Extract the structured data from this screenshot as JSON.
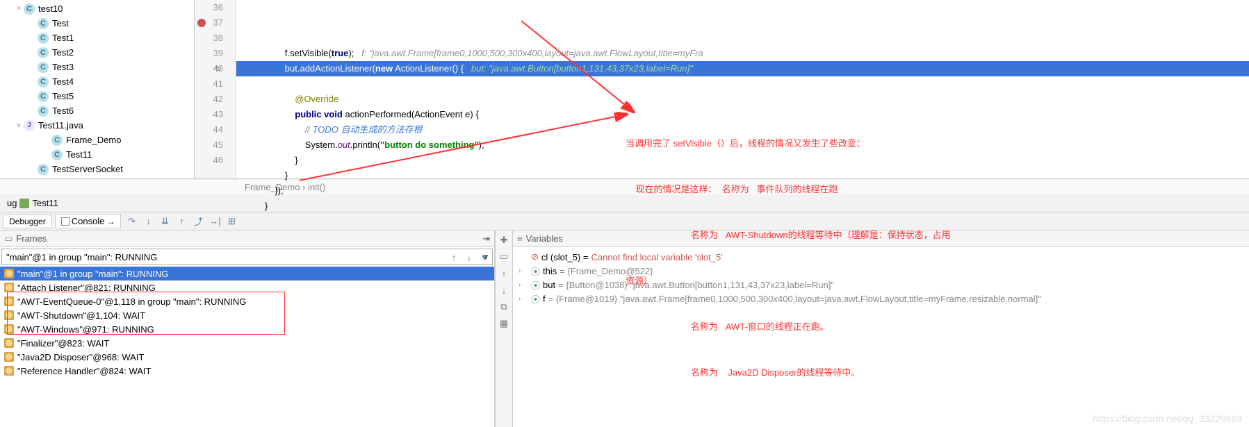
{
  "tree": {
    "items": [
      {
        "level": 0,
        "chev": ">",
        "icon": "C",
        "label": "test10"
      },
      {
        "level": 1,
        "chev": "",
        "icon": "C",
        "label": "Test"
      },
      {
        "level": 1,
        "chev": "",
        "icon": "C",
        "label": "Test1"
      },
      {
        "level": 1,
        "chev": "",
        "icon": "C",
        "label": "Test2"
      },
      {
        "level": 1,
        "chev": "",
        "icon": "C",
        "label": "Test3"
      },
      {
        "level": 1,
        "chev": "",
        "icon": "C",
        "label": "Test4"
      },
      {
        "level": 1,
        "chev": "",
        "icon": "C",
        "label": "Test5"
      },
      {
        "level": 1,
        "chev": "",
        "icon": "C",
        "label": "Test6"
      },
      {
        "level": 0,
        "chev": "v",
        "icon": "J",
        "label": "Test11.java"
      },
      {
        "level": 2,
        "chev": "",
        "icon": "C",
        "label": "Frame_Demo"
      },
      {
        "level": 2,
        "chev": "",
        "icon": "C",
        "label": "Test11"
      },
      {
        "level": 1,
        "chev": "",
        "icon": "C",
        "label": "TestServerSocket"
      }
    ]
  },
  "editor": {
    "lines": [
      {
        "n": 36,
        "bp": false,
        "indent": "                ",
        "html": "f.setVisible(<span class='kw'>true</span>);   <span class='ihint'>f: \"java.awt.Frame[frame0,1000,500,300x400,layout=java.awt.FlowLayout,title=myFra</span>"
      },
      {
        "n": 37,
        "bp": true,
        "hl": true,
        "indent": "                ",
        "html": "but.addActionListener(<span class='kw'>new</span> ActionListener() {   <span class='ihint'>but: \"java.awt.Button[button1,131,43,37x23,label=Run]\"</span>"
      },
      {
        "n": 38,
        "indent": "",
        "html": ""
      },
      {
        "n": 39,
        "indent": "                    ",
        "html": "<span class='ann'>@Override</span>"
      },
      {
        "n": 40,
        "over": true,
        "indent": "                    ",
        "html": "<span class='kw'>public void</span> actionPerformed(ActionEvent e) {"
      },
      {
        "n": 41,
        "indent": "                        ",
        "html": "<span class='cm'>// </span><span class='cm2'>TODO 自动生成的方法存根</span>"
      },
      {
        "n": 42,
        "indent": "                        ",
        "html": "System.<span style='color:#660e7a;font-style:italic'>out</span>.println(<span class='str'>\"button do something\"</span>);"
      },
      {
        "n": 43,
        "indent": "                    ",
        "html": "}"
      },
      {
        "n": 44,
        "indent": "                ",
        "html": "}"
      },
      {
        "n": 45,
        "indent": "            ",
        "html": "});"
      },
      {
        "n": 46,
        "indent": "        ",
        "html": "}"
      }
    ],
    "breadcrumb": "Frame_Demo  ›  init()"
  },
  "annotations": {
    "line1": "当调用完了 setVisible（）后，线程的情况又发生了些改变：",
    "line2": "    现在的情况是这样：  名称为   事件队列的线程在跑",
    "line3": "                          名称为   AWT-Shutdown的线程等待中（理解是：保持状态，占用",
    "line4": "资源）",
    "line5": "                          名称为   AWT-窗口的线程正在跑。",
    "line6": "                          名称为    Java2D Disposer的线程等待中。"
  },
  "debugTab": {
    "label": "Test11",
    "prefix": "ug"
  },
  "debugger": {
    "tabDebugger": "Debugger",
    "tabConsole": "Console",
    "framesTitle": "Frames",
    "variablesTitle": "Variables",
    "selectedThread": "\"main\"@1 in group \"main\": RUNNING",
    "threads": [
      "\"main\"@1 in group \"main\": RUNNING",
      "\"Attach Listener\"@821: RUNNING",
      "\"AWT-EventQueue-0\"@1,118 in group \"main\": RUNNING",
      "\"AWT-Shutdown\"@1,104: WAIT",
      "\"AWT-Windows\"@971: RUNNING",
      "\"Finalizer\"@823: WAIT",
      "\"Java2D Disposer\"@968: WAIT",
      "\"Reference Handler\"@824: WAIT"
    ],
    "variables": {
      "error": {
        "name": "cl (slot_5) = ",
        "msg": "Cannot find local variable 'slot_5'"
      },
      "rows": [
        {
          "name": "this",
          "val": " = {Frame_Demo@522}"
        },
        {
          "name": "but",
          "val": " = {Button@1038} \"java.awt.Button[button1,131,43,37x23,label=Run]\""
        },
        {
          "name": "f",
          "val": " = {Frame@1019} \"java.awt.Frame[frame0,1000,500,300x400,layout=java.awt.FlowLayout,title=myFrame,resizable,normal]\""
        }
      ]
    }
  },
  "watermark": "https://blog.csdn.net/qq_33229669"
}
